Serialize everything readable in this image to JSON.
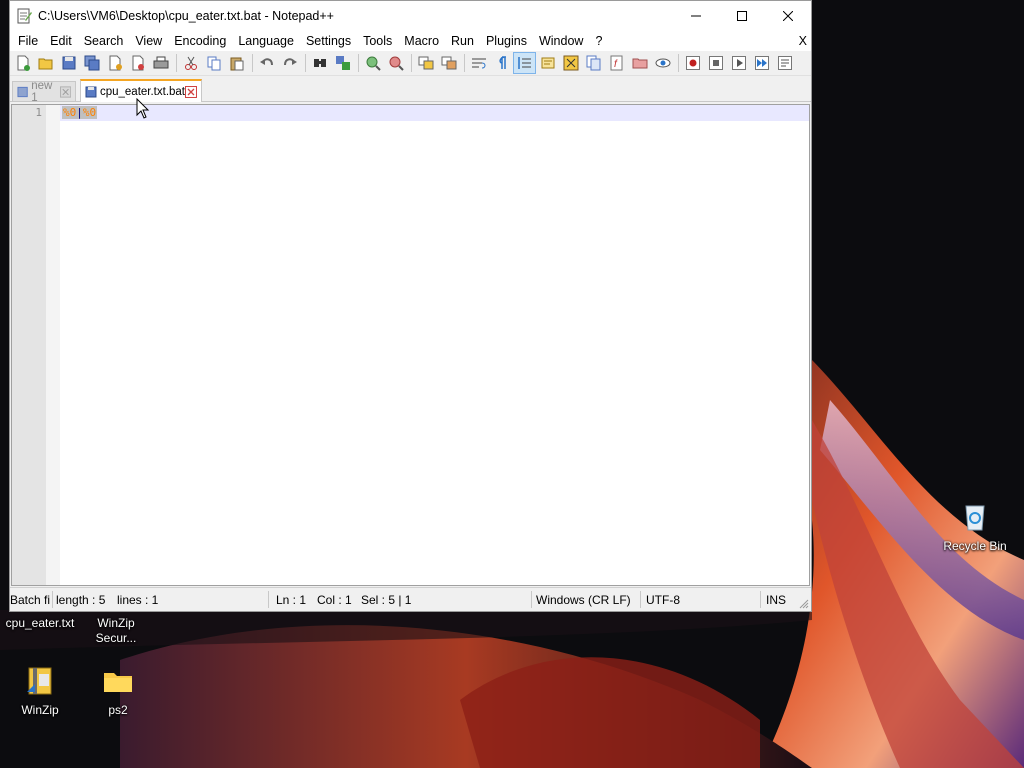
{
  "window": {
    "title": "C:\\Users\\VM6\\Desktop\\cpu_eater.txt.bat - Notepad++"
  },
  "menu": {
    "items": [
      "File",
      "Edit",
      "Search",
      "View",
      "Encoding",
      "Language",
      "Settings",
      "Tools",
      "Macro",
      "Run",
      "Plugins",
      "Window",
      "?"
    ],
    "close_label": "X"
  },
  "toolbar": {
    "icons": [
      "new-file-icon",
      "open-file-icon",
      "save-icon",
      "save-all-icon",
      "close-icon",
      "close-all-icon",
      "print-icon",
      "cut-icon",
      "copy-icon",
      "paste-icon",
      "undo-icon",
      "redo-icon",
      "find-icon",
      "replace-icon",
      "zoom-in-icon",
      "zoom-out-icon",
      "sync-vertical-icon",
      "sync-horizontal-icon",
      "word-wrap-icon",
      "show-all-chars-icon",
      "indent-guide-icon",
      "udl-icon",
      "document-map-icon",
      "document-list-icon",
      "function-list-icon",
      "folder-workspace-icon",
      "monitoring-icon",
      "record-macro-icon",
      "stop-record-icon",
      "playback-macro-icon",
      "run-macro-multiple-icon",
      "save-macro-icon"
    ]
  },
  "tabs": [
    {
      "label": "new 1",
      "active": false
    },
    {
      "label": "cpu_eater.txt.bat",
      "active": true
    }
  ],
  "editor": {
    "line_number": "1",
    "code_part1": "%0",
    "code_op": "|",
    "code_part2": "%0"
  },
  "status": {
    "filetype": "Batch fi",
    "length": "length : 5",
    "lines": "lines : 1",
    "ln": "Ln : 1",
    "col": "Col : 1",
    "sel": "Sel : 5 | 1",
    "eol": "Windows (CR LF)",
    "encoding": "UTF-8",
    "mode": "INS"
  },
  "desktop": {
    "icons": [
      {
        "label": "cpu_eater.txt"
      },
      {
        "label1": "WinZip",
        "label2": "Secur..."
      },
      {
        "label": "WinZip"
      },
      {
        "label": "ps2"
      },
      {
        "label": "Recycle Bin"
      }
    ]
  },
  "colors": {
    "accent_tab": "#f5a623",
    "selection": "#c0c0c0",
    "batch_variable": "#ff8000"
  }
}
